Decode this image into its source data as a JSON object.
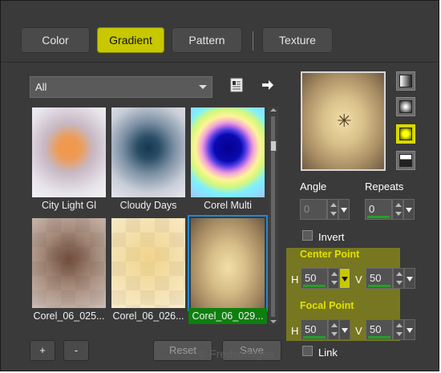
{
  "tabs": {
    "color": "Color",
    "gradient": "Gradient",
    "pattern": "Pattern",
    "texture": "Texture"
  },
  "category": {
    "value": "All"
  },
  "thumbnails": [
    {
      "name": "City Light Gl"
    },
    {
      "name": "Cloudy Days"
    },
    {
      "name": "Corel Multi"
    },
    {
      "name": "Corel_06_025..."
    },
    {
      "name": "Corel_06_026..."
    },
    {
      "name": "Corel_06_029...",
      "selected": true
    }
  ],
  "buttons": {
    "add": "+",
    "remove": "-",
    "reset": "Reset",
    "save": "Save"
  },
  "options": {
    "angle_label": "Angle",
    "angle_value": "0",
    "repeats_label": "Repeats",
    "repeats_value": "0",
    "invert_label": "Invert",
    "link_label": "Link"
  },
  "center_point": {
    "title": "Center Point",
    "h_label": "H",
    "h_value": "50",
    "v_label": "V",
    "v_value": "50"
  },
  "focal_point": {
    "title": "Focal Point",
    "h_label": "H",
    "h_value": "50",
    "v_label": "V",
    "v_value": "50"
  },
  "watermark": "© Fredsimages",
  "colors": {
    "accent": "#c8c800",
    "selection": "#1c8ad8",
    "selected_caption": "#0e7f0e"
  },
  "icons": [
    "library-icon",
    "arrow-right-icon",
    "linear-style-icon",
    "rectangular-style-icon",
    "radial-style-icon",
    "sunburst-style-icon",
    "center-point-icon"
  ]
}
